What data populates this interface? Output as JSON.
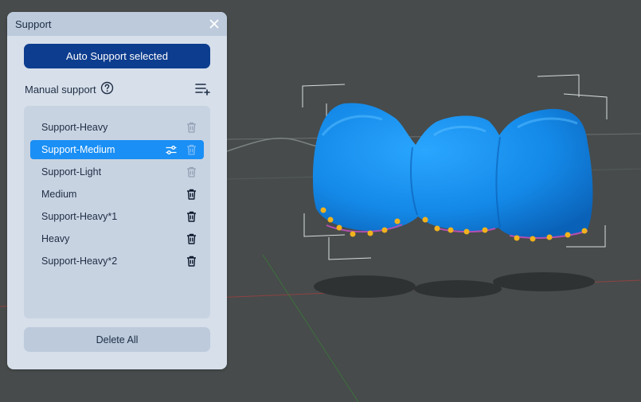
{
  "panel": {
    "title": "Support",
    "auto_support_label": "Auto Support selected",
    "manual_support_label": "Manual support",
    "delete_all_label": "Delete All",
    "items": [
      {
        "label": "Support-Heavy",
        "state": "dimmed"
      },
      {
        "label": "Support-Medium",
        "state": "selected"
      },
      {
        "label": "Support-Light",
        "state": "dimmed"
      },
      {
        "label": "Medium",
        "state": "normal"
      },
      {
        "label": "Support-Heavy*1",
        "state": "normal"
      },
      {
        "label": "Heavy",
        "state": "normal"
      },
      {
        "label": "Support-Heavy*2",
        "state": "normal"
      }
    ]
  },
  "icons": {
    "close": "close-icon",
    "help": "help-icon",
    "add_list": "add-list-icon",
    "trash": "trash-icon",
    "adjust": "adjust-icon"
  },
  "colors": {
    "viewport_bg": "#474b4b",
    "panel_bg": "#d6dfea",
    "primary_button": "#0d3d8f",
    "selected_item": "#1a8ff5",
    "model_blue": "#1e8ff0",
    "support_gold": "#f2b21c"
  }
}
